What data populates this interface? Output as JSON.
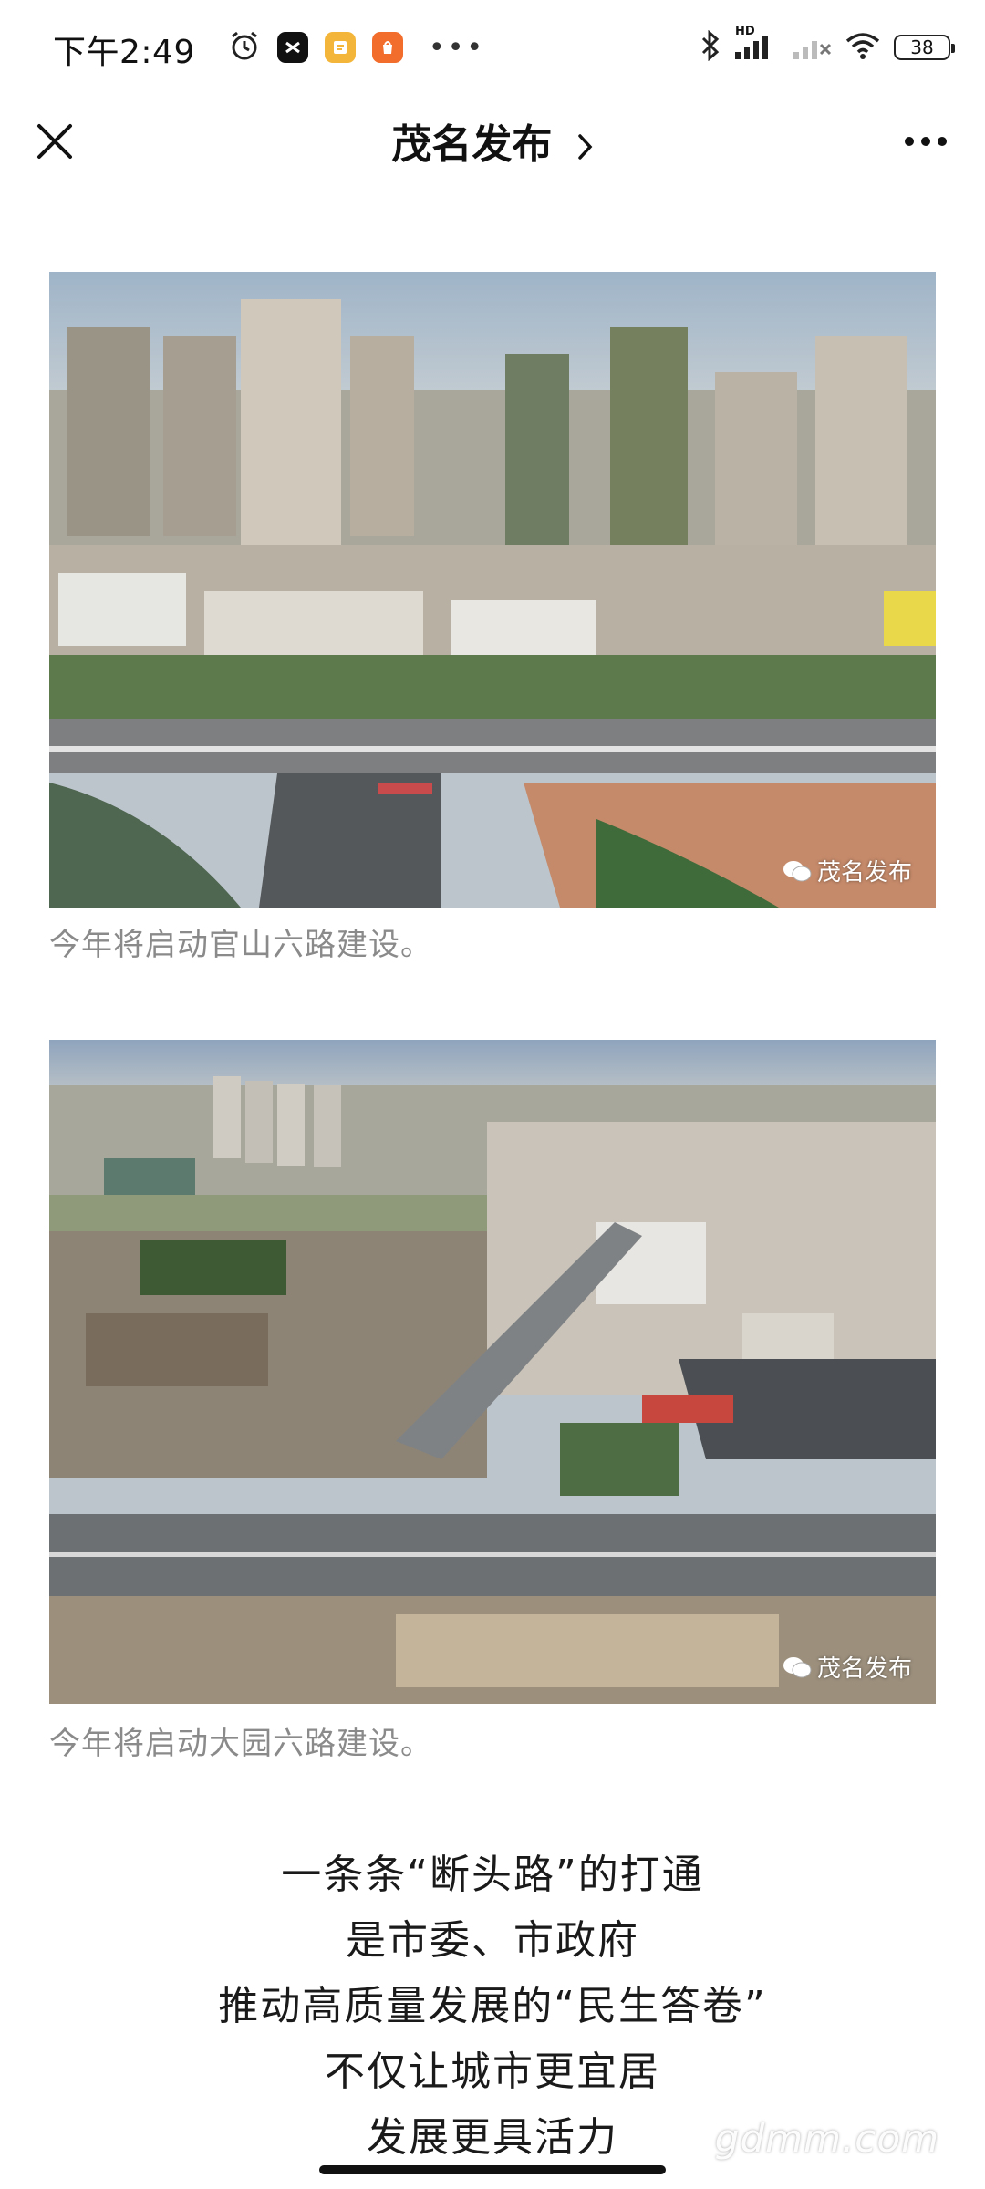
{
  "status_bar": {
    "time": "下午2:49",
    "battery": "38",
    "icons": [
      "alarm-icon",
      "capcut-app-icon",
      "notes-app-icon",
      "mi-store-app-icon",
      "more-dots-icon",
      "bluetooth-icon",
      "hd-signal-icon",
      "wifi-icon",
      "battery-icon"
    ],
    "hd_label": "HD"
  },
  "nav": {
    "title": "茂名发布",
    "icons": [
      "close-icon",
      "chevron-right-icon",
      "more-icon"
    ]
  },
  "article": {
    "images": [
      {
        "watermark": "茂名发布",
        "caption": "今年将启动官山六路建设。"
      },
      {
        "watermark": "茂名发布",
        "caption": "今年将启动大园六路建设。"
      }
    ],
    "lines": [
      "一条条“断头路”的打通",
      "是市委、市政府",
      "推动高质量发展的“民生答卷”",
      "不仅让城市更宜居",
      "发展更具活力"
    ]
  },
  "site_watermark": "gdmm.com",
  "colors": {
    "caption": "#8a8a8a",
    "text": "#1a1a1a",
    "sky": "#9fb4c8"
  }
}
